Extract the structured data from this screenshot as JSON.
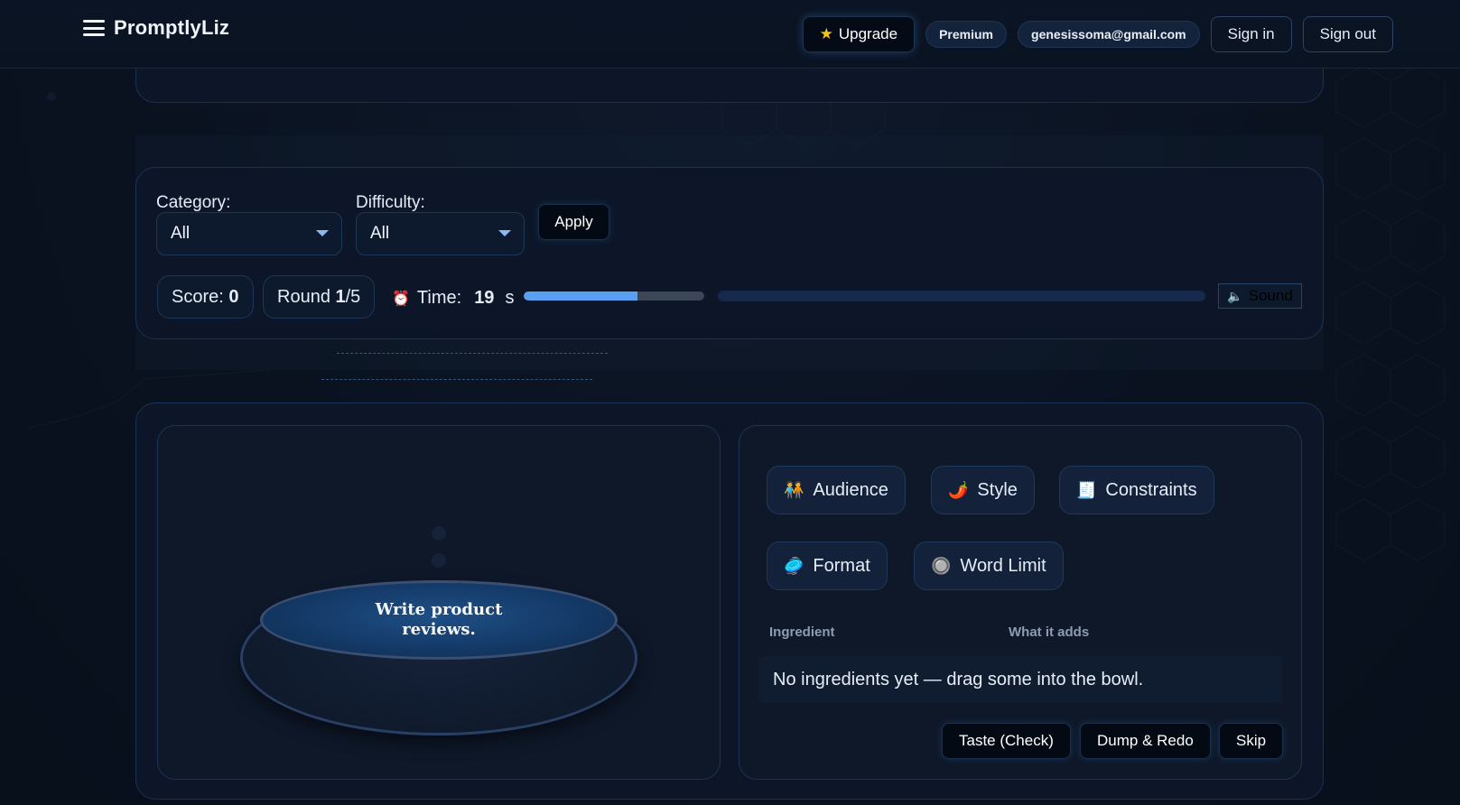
{
  "header": {
    "brand": "PromptlyLiz",
    "upgrade_label": "Upgrade",
    "plan_badge": "Premium",
    "email": "genesissoma@gmail.com",
    "sign_in": "Sign in",
    "sign_out": "Sign out"
  },
  "filters": {
    "category_label": "Category:",
    "category_value": "All",
    "difficulty_label": "Difficulty:",
    "difficulty_value": "All",
    "apply_label": "Apply"
  },
  "status": {
    "score_label": "Score:",
    "score_value": "0",
    "round_label": "Round",
    "round_current": "1",
    "round_total": "/5",
    "time_label": "Time:",
    "time_value": "19",
    "time_unit": "s",
    "time_progress": 0.63,
    "sound_label": "Sound"
  },
  "bowl": {
    "task": "Write product reviews."
  },
  "ingredients": {
    "chips": [
      {
        "label": "Audience",
        "icon": "people-icon"
      },
      {
        "label": "Style",
        "icon": "chili-icon"
      },
      {
        "label": "Constraints",
        "icon": "receipt-icon"
      },
      {
        "label": "Format",
        "icon": "format-icon"
      },
      {
        "label": "Word Limit",
        "icon": "counter-icon"
      }
    ],
    "col_ingredient": "Ingredient",
    "col_adds": "What it adds",
    "empty_message": "No ingredients yet — drag some into the bowl."
  },
  "actions": {
    "taste": "Taste (Check)",
    "dump": "Dump & Redo",
    "skip": "Skip"
  }
}
